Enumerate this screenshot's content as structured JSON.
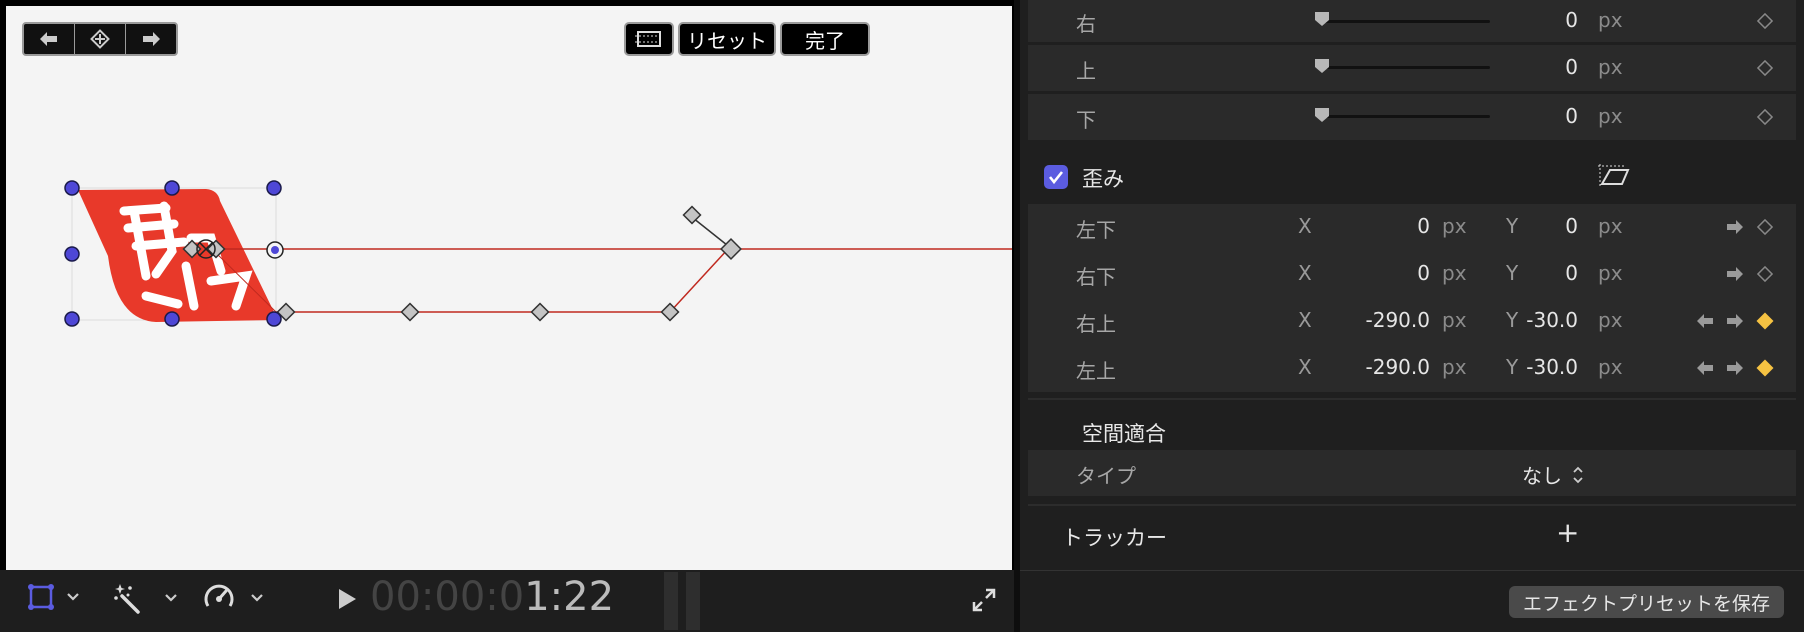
{
  "viewer": {
    "buttons": {
      "reset_label": "リセット",
      "done_label": "完了"
    },
    "timecode": {
      "dim": "00:00:0",
      "lit": "1:22"
    }
  },
  "inspector": {
    "crop_rows": [
      {
        "label": "右",
        "value": "0",
        "unit": "px"
      },
      {
        "label": "上",
        "value": "0",
        "unit": "px"
      },
      {
        "label": "下",
        "value": "0",
        "unit": "px"
      }
    ],
    "distort": {
      "title": "歪み",
      "checked": true,
      "rows": [
        {
          "label": "左下",
          "x_axis": "X",
          "x_value": "0",
          "x_unit": "px",
          "y_axis": "Y",
          "y_value": "0",
          "y_unit": "px",
          "keyframed": false
        },
        {
          "label": "右下",
          "x_axis": "X",
          "x_value": "0",
          "x_unit": "px",
          "y_axis": "Y",
          "y_value": "0",
          "y_unit": "px",
          "keyframed": false
        },
        {
          "label": "右上",
          "x_axis": "X",
          "x_value": "-290.0",
          "x_unit": "px",
          "y_axis": "Y",
          "y_value": "-30.0",
          "y_unit": "px",
          "keyframed": true
        },
        {
          "label": "左上",
          "x_axis": "X",
          "x_value": "-290.0",
          "x_unit": "px",
          "y_axis": "Y",
          "y_value": "-30.0",
          "y_unit": "px",
          "keyframed": true
        }
      ]
    },
    "spatial": {
      "title": "空間適合",
      "type_label": "タイプ",
      "type_value": "なし"
    },
    "tracker": {
      "title": "トラッカー",
      "add_symbol": "+"
    },
    "footer": {
      "save_preset_label": "エフェクトプリセットを保存"
    }
  },
  "colors": {
    "accent": "#5b5ce0",
    "keyframe_active": "#f5c242",
    "motion_path": "#c0291f",
    "handle": "#4e47d6"
  },
  "icons": [
    "prev-keyframe-icon",
    "add-keyframe-icon",
    "next-keyframe-icon",
    "crop-overlay-icon",
    "transform-icon",
    "magic-wand-icon",
    "speed-icon",
    "play-icon",
    "fullscreen-icon",
    "distort-icon",
    "chevron-down-icon",
    "keyframe-diamond-icon"
  ]
}
